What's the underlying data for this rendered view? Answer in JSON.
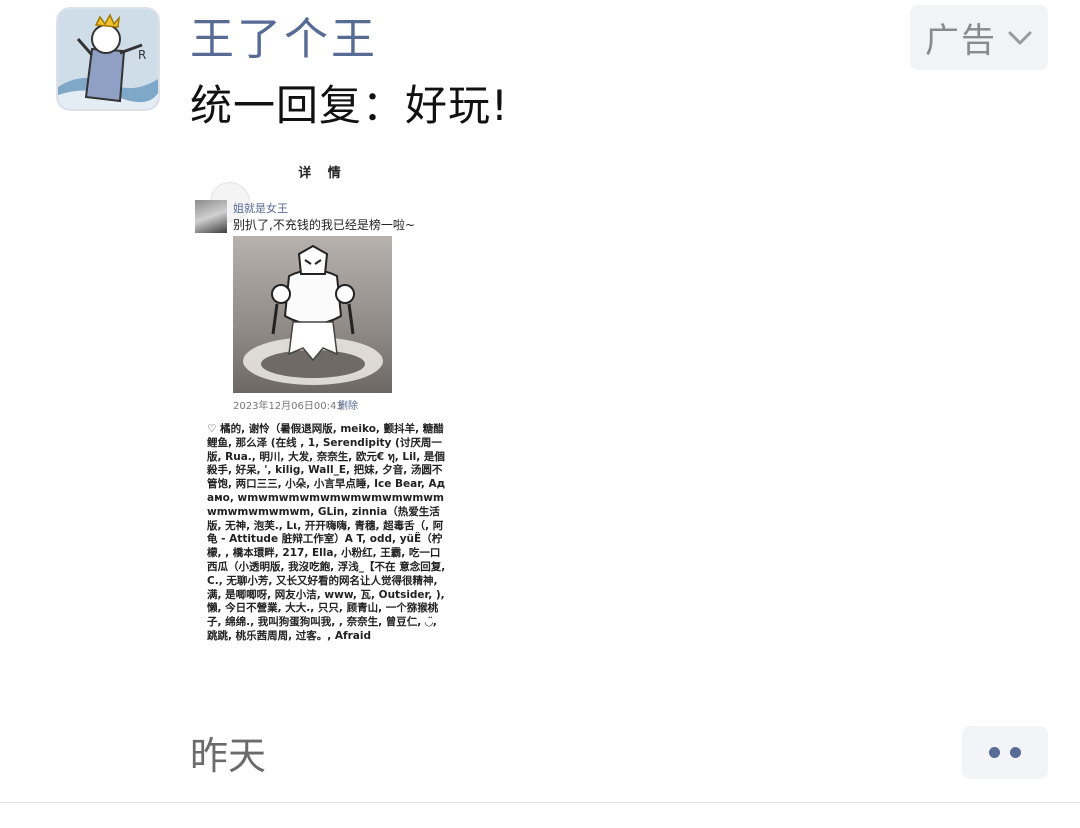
{
  "post": {
    "author_name": "王了个王",
    "text": "统一回复：好玩!",
    "ad_label": "广告",
    "time": "昨天"
  },
  "embedded_screenshot": {
    "title": "详 情",
    "author": "姐就是女王",
    "caption": "别扒了,不充钱的我已经是榜一啦~",
    "timestamp": "2023年12月06日00:43",
    "delete_label": "删除",
    "likes": "♡ 橘的, 谢怜（暑假退网版, meiko, 颤抖羊, 糖醋鲤鱼, 那么泽 (在线 , 1, Serendipity (讨厌周一版, Rua., 明川, 大发, 奈奈生, 欧元€ ทุ, Lil, 是個殺手, 好呆, ', kilig, Wall_E, 把妹, 夕音, 汤圆不管饱, 两口三三, 小朵, 小言早点睡, Ice Bear, Адамо, wmwmwmwmwmwmwmwmwmwmwmwmwmwmwm, GLin, zinnia（热爱生活版, 无神, 泡芙., Lι, 开开嗨嗨, 青穗, 超毒舌（, 阿龟 - Attitude 脏辩工作室）A T, odd, yüË（柠檬, , 橋本環畔, 217, Ella, 小粉红, 王霸, 吃一口西瓜（小透明版, 我沒吃飽, 浮浅_【不在 意念回复, C., 无聊小芳, 又长又好看的网名让人觉得很精神, 满, 是唧唧呀, 网友小洁, www, 瓦, Outsider, ), 懒, 今日不營業, 大大., 只只, 顾青山, 一个猕猴桃子, 绵绵., 我叫狗蛋狗叫我, , 奈奈生, 曾豆仁, ◡̈, 跳跳, 桃乐茜周周, 过客。, Afraid"
  },
  "colors": {
    "link_blue": "#576b95",
    "badge_bg": "#f2f3f5",
    "time_gray": "#6b6b6b"
  },
  "icons": [
    "app-avatar-icon",
    "chevron-down-icon",
    "more-dots-icon"
  ]
}
